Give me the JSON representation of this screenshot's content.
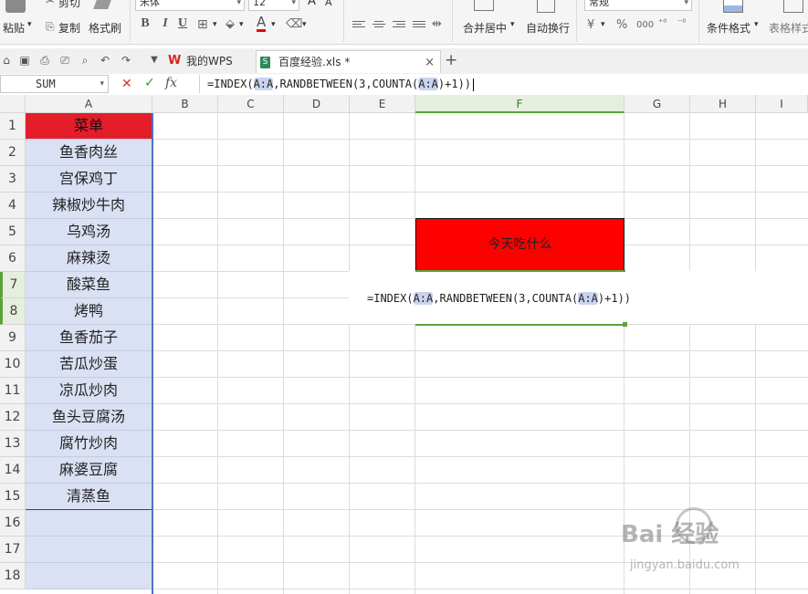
{
  "ribbon": {
    "paste_label": "粘贴",
    "cut_label": "剪切",
    "copy_label": "复制",
    "format_painter_label": "格式刷",
    "font_name": "宋体",
    "font_size": "12",
    "bold": "B",
    "italic": "I",
    "underline": "U",
    "merge_center_label": "合并居中",
    "wrap_text_label": "自动换行",
    "number_format": "常规",
    "conditional_format_label": "条件格式",
    "table_style_label": "表格样式",
    "percent": "%",
    "comma": "000"
  },
  "tabs": [
    {
      "label": "我的WPS"
    },
    {
      "label": "百度经验.xls *"
    }
  ],
  "formula_bar": {
    "name_box": "SUM",
    "fx": "fx",
    "formula_parts": [
      "=INDEX(",
      "A:A",
      ",RANDBETWEEN(3,COUNTA(",
      "A:A",
      ")+1))"
    ]
  },
  "columns": [
    "A",
    "B",
    "C",
    "D",
    "E",
    "F",
    "G",
    "H",
    "I"
  ],
  "rows": [
    "1",
    "2",
    "3",
    "4",
    "5",
    "6",
    "7",
    "8",
    "9",
    "10",
    "11",
    "12",
    "13",
    "14",
    "15",
    "16",
    "17",
    "18"
  ],
  "column_a": [
    "菜单",
    "鱼香肉丝",
    "宫保鸡丁",
    "辣椒炒牛肉",
    "乌鸡汤",
    "麻辣烫",
    "酸菜鱼",
    "烤鸭",
    "鱼香茄子",
    "苦瓜炒蛋",
    "凉瓜炒肉",
    "鱼头豆腐汤",
    "腐竹炒肉",
    "麻婆豆腐",
    "清蒸鱼"
  ],
  "f_header": "今天吃什么",
  "f_edit_formula_parts": [
    "=INDEX(",
    "A:A",
    ",RANDBETWEEN(3,COUNTA(",
    "A:A",
    ")+1))"
  ],
  "watermark": {
    "text": "Bai 经验",
    "sub": "jingyan.baidu.com"
  },
  "colors": {
    "header_red": "#e41d2a",
    "cell_red": "#ff0000",
    "col_a_fill": "#dbe1f4",
    "selection_green": "#5aa23a",
    "ref_highlight": "#c9d3ee"
  }
}
